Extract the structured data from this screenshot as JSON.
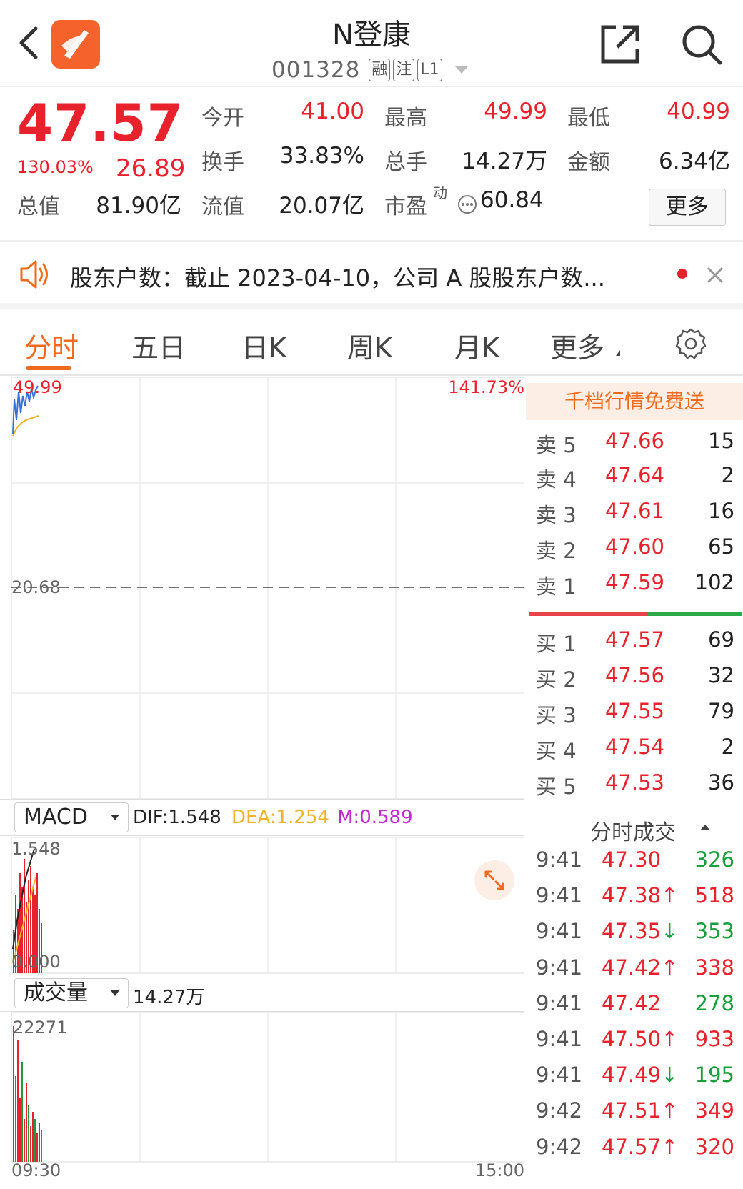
{
  "header": {
    "stock_name": "N登康",
    "stock_code": "001328",
    "tags": [
      "融",
      "注",
      "L1"
    ]
  },
  "quote": {
    "last_price": "47.57",
    "change_pct": "130.03%",
    "change_amt": "26.89",
    "fields": [
      {
        "label": "今开",
        "value": "41.00",
        "color": "red"
      },
      {
        "label": "最高",
        "value": "49.99",
        "color": "red"
      },
      {
        "label": "最低",
        "value": "40.99",
        "color": "red"
      },
      {
        "label": "换手",
        "value": "33.83%",
        "color": "black"
      },
      {
        "label": "总手",
        "value": "14.27万",
        "color": "black"
      },
      {
        "label": "金额",
        "value": "6.34亿",
        "color": "black"
      },
      {
        "label": "总值",
        "value": "81.90亿",
        "color": "black"
      },
      {
        "label": "流值",
        "value": "20.07亿",
        "color": "black"
      },
      {
        "label": "市盈",
        "value": "60.84",
        "color": "black"
      }
    ],
    "pe_superscript": "动",
    "more_label": "更多"
  },
  "news": {
    "text": "股东户数：截止 2023-04-10，公司 A 股股东户数..."
  },
  "tabs": {
    "items": [
      "分时",
      "五日",
      "日K",
      "周K",
      "月K",
      "更多"
    ],
    "active_index": 0
  },
  "chart": {
    "price_high_label": "49.99",
    "pct_high_label": "141.73%",
    "prev_close_label": "20.68",
    "macd_selector": "MACD",
    "dif_label": "DIF:1.548",
    "dea_label": "DEA:1.254",
    "m_label": "M:0.589",
    "macd_max_label": "1.548",
    "macd_zero_label": "0.000",
    "volume_selector": "成交量",
    "volume_total": "14.27万",
    "volume_max_label": "22271",
    "time_start": "09:30",
    "time_end": "15:00",
    "colors": {
      "up": "#e8222c",
      "down": "#1a9e3c",
      "price_line": "#3a6fd8",
      "avg_line": "#f0b42a",
      "dea": "#f0b42a",
      "m": "#c02ad0"
    }
  },
  "orderbook": {
    "promo": "千档行情免费送",
    "asks": [
      {
        "label": "卖 5",
        "price": "47.66",
        "vol": "15"
      },
      {
        "label": "卖 4",
        "price": "47.64",
        "vol": "2"
      },
      {
        "label": "卖 3",
        "price": "47.61",
        "vol": "16"
      },
      {
        "label": "卖 2",
        "price": "47.60",
        "vol": "65"
      },
      {
        "label": "卖 1",
        "price": "47.59",
        "vol": "102"
      }
    ],
    "bids": [
      {
        "label": "买 1",
        "price": "47.57",
        "vol": "69"
      },
      {
        "label": "买 2",
        "price": "47.56",
        "vol": "32"
      },
      {
        "label": "买 3",
        "price": "47.55",
        "vol": "79"
      },
      {
        "label": "买 4",
        "price": "47.54",
        "vol": "2"
      },
      {
        "label": "买 5",
        "price": "47.53",
        "vol": "36"
      }
    ]
  },
  "ticks": {
    "title": "分时成交",
    "rows": [
      {
        "time": "9:41",
        "price": "47.30",
        "arrow": "",
        "vol": "326",
        "side": "buy"
      },
      {
        "time": "9:41",
        "price": "47.38",
        "arrow": "↑",
        "vol": "518",
        "side": "buy"
      },
      {
        "time": "9:41",
        "price": "47.35",
        "arrow": "↓",
        "vol": "353",
        "side": "sell"
      },
      {
        "time": "9:41",
        "price": "47.42",
        "arrow": "↑",
        "vol": "338",
        "side": "buy"
      },
      {
        "time": "9:41",
        "price": "47.42",
        "arrow": "",
        "vol": "278",
        "side": "buy"
      },
      {
        "time": "9:41",
        "price": "47.50",
        "arrow": "↑",
        "vol": "933",
        "side": "buy"
      },
      {
        "time": "9:41",
        "price": "47.49",
        "arrow": "↓",
        "vol": "195",
        "side": "sell"
      },
      {
        "time": "9:42",
        "price": "47.51",
        "arrow": "↑",
        "vol": "349",
        "side": "buy"
      },
      {
        "time": "9:42",
        "price": "47.57",
        "arrow": "↑",
        "vol": "320",
        "side": "buy"
      }
    ]
  }
}
